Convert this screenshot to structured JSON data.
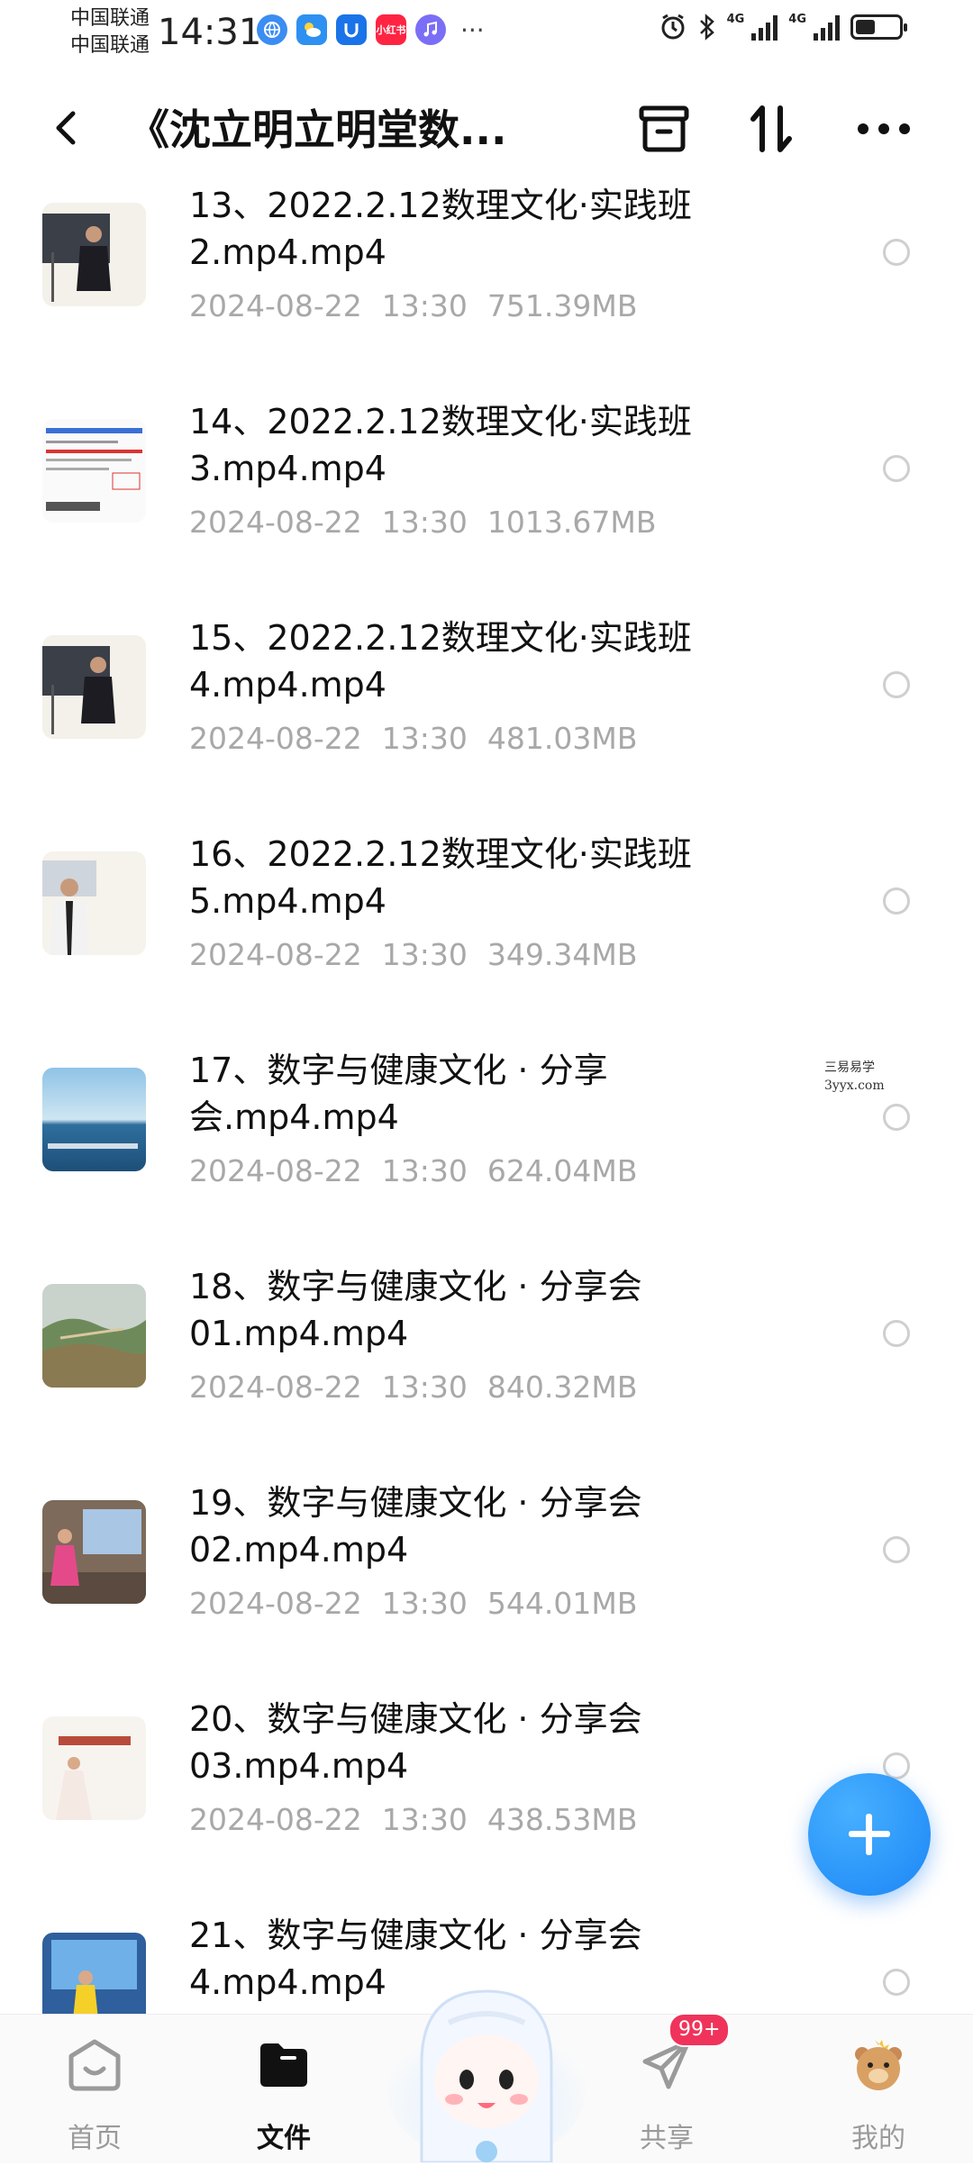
{
  "status_bar": {
    "carrier_1": "中国联通",
    "carrier_2": "中国联通",
    "time": "14:31",
    "app_icons": [
      "browser-icon",
      "weather-icon",
      "u-app-icon",
      "xiaohongshu-icon",
      "music-icon"
    ],
    "xiaohongshu_label": "小红书",
    "more": "···",
    "network_1": "4G",
    "network_2": "4G",
    "battery_level": 0.45
  },
  "header": {
    "title": "《沈立明立明堂数...",
    "icons": [
      "back-icon",
      "archive-icon",
      "sort-icon",
      "more-icon"
    ]
  },
  "files": [
    {
      "name": "13、2022.2.12数理文化·实践班\n2.mp4.mp4",
      "date": "2024-08-22",
      "time": "13:30",
      "size": "751.39MB",
      "thumb": "man-lecturing-dark-screen"
    },
    {
      "name": "14、2022.2.12数理文化·实践班\n3.mp4.mp4",
      "date": "2024-08-22",
      "time": "13:30",
      "size": "1013.67MB",
      "thumb": "document-slide"
    },
    {
      "name": "15、2022.2.12数理文化·实践班\n4.mp4.mp4",
      "date": "2024-08-22",
      "time": "13:30",
      "size": "481.03MB",
      "thumb": "man-lecturing-dark-screen"
    },
    {
      "name": "16、2022.2.12数理文化·实践班\n5.mp4.mp4",
      "date": "2024-08-22",
      "time": "13:30",
      "size": "349.34MB",
      "thumb": "man-white-jacket"
    },
    {
      "name": "17、数字与健康文化 · 分享\n会.mp4.mp4",
      "date": "2024-08-22",
      "time": "13:30",
      "size": "624.04MB",
      "thumb": "sea-and-sky"
    },
    {
      "name": "18、数字与健康文化 · 分享会\n01.mp4.mp4",
      "date": "2024-08-22",
      "time": "13:30",
      "size": "840.32MB",
      "thumb": "great-wall-landscape"
    },
    {
      "name": "19、数字与健康文化 · 分享会\n02.mp4.mp4",
      "date": "2024-08-22",
      "time": "13:30",
      "size": "544.01MB",
      "thumb": "woman-on-stage"
    },
    {
      "name": "20、数字与健康文化 · 分享会\n03.mp4.mp4",
      "date": "2024-08-22",
      "time": "13:30",
      "size": "438.53MB",
      "thumb": "woman-white-dress"
    },
    {
      "name": "21、数字与健康文化 · 分享会\n4.mp4.mp4",
      "date": "",
      "time": "",
      "size": "",
      "thumb": "woman-yellow-on-stage"
    }
  ],
  "watermark": {
    "line1": "三易易学",
    "line2": "3yyx.com"
  },
  "fab": {
    "icon": "plus-icon"
  },
  "bottom_nav": {
    "items": [
      {
        "label": "首页",
        "icon": "home-icon",
        "active": false
      },
      {
        "label": "文件",
        "icon": "folder-icon",
        "active": true
      },
      {
        "label": "",
        "icon": "mascot-icon",
        "active": false
      },
      {
        "label": "共享",
        "icon": "share-icon",
        "active": false,
        "badge": "99+"
      },
      {
        "label": "我的",
        "icon": "profile-icon",
        "active": false
      }
    ]
  },
  "colors": {
    "accent": "#1b86f6",
    "badge": "#f0335a",
    "meta_text": "#a8a8a8"
  }
}
